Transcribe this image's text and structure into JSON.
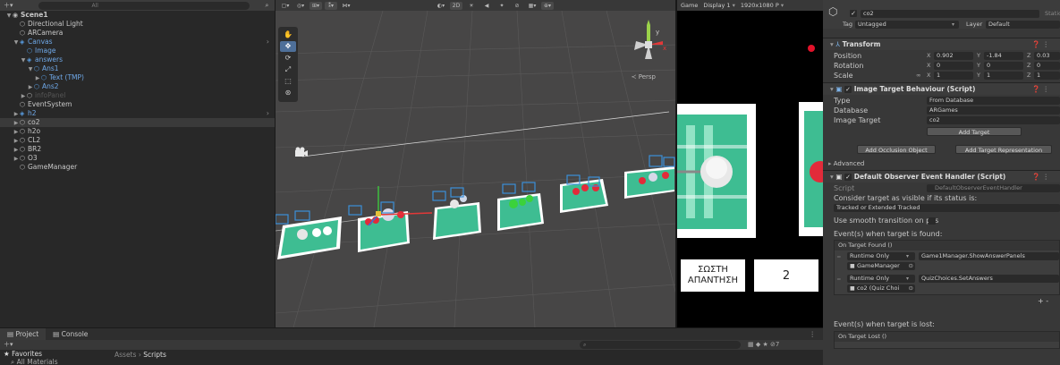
{
  "hierarchy": {
    "search_placeholder": "All",
    "rows": [
      {
        "name": "Scene1",
        "depth": 0,
        "arrow": "▼",
        "icon": "scene",
        "selected": false,
        "blue": false,
        "dim": false,
        "chev": false
      },
      {
        "name": "Directional Light",
        "depth": 1,
        "arrow": "",
        "icon": "cube",
        "selected": false,
        "blue": false,
        "dim": false,
        "chev": false
      },
      {
        "name": "ARCamera",
        "depth": 1,
        "arrow": "",
        "icon": "cube",
        "selected": false,
        "blue": false,
        "dim": false,
        "chev": false
      },
      {
        "name": "Canvas",
        "depth": 1,
        "arrow": "▼",
        "icon": "prefab",
        "selected": false,
        "blue": true,
        "dim": false,
        "chev": true
      },
      {
        "name": "Image",
        "depth": 2,
        "arrow": "",
        "icon": "cube",
        "selected": false,
        "blue": true,
        "dim": false,
        "chev": false
      },
      {
        "name": "answers",
        "depth": 2,
        "arrow": "▼",
        "icon": "prefab",
        "selected": false,
        "blue": true,
        "dim": false,
        "chev": false
      },
      {
        "name": "Ans1",
        "depth": 3,
        "arrow": "▼",
        "icon": "cube",
        "selected": false,
        "blue": true,
        "dim": false,
        "chev": false
      },
      {
        "name": "Text (TMP)",
        "depth": 4,
        "arrow": "▶",
        "icon": "cube",
        "selected": false,
        "blue": true,
        "dim": false,
        "chev": false
      },
      {
        "name": "Ans2",
        "depth": 3,
        "arrow": "▶",
        "icon": "cube",
        "selected": false,
        "blue": true,
        "dim": false,
        "chev": false
      },
      {
        "name": "infoPanel",
        "depth": 2,
        "arrow": "▶",
        "icon": "cube",
        "selected": false,
        "blue": false,
        "dim": true,
        "chev": false
      },
      {
        "name": "EventSystem",
        "depth": 1,
        "arrow": "",
        "icon": "cube",
        "selected": false,
        "blue": false,
        "dim": false,
        "chev": false
      },
      {
        "name": "h2",
        "depth": 1,
        "arrow": "▶",
        "icon": "prefab",
        "selected": false,
        "blue": true,
        "dim": false,
        "chev": true
      },
      {
        "name": "co2",
        "depth": 1,
        "arrow": "▶",
        "icon": "cube",
        "selected": true,
        "blue": false,
        "dim": false,
        "chev": false
      },
      {
        "name": "h2o",
        "depth": 1,
        "arrow": "▶",
        "icon": "cube",
        "selected": false,
        "blue": false,
        "dim": false,
        "chev": false
      },
      {
        "name": "CL2",
        "depth": 1,
        "arrow": "▶",
        "icon": "cube",
        "selected": false,
        "blue": false,
        "dim": false,
        "chev": false
      },
      {
        "name": "BR2",
        "depth": 1,
        "arrow": "▶",
        "icon": "cube",
        "selected": false,
        "blue": false,
        "dim": false,
        "chev": false
      },
      {
        "name": "O3",
        "depth": 1,
        "arrow": "▶",
        "icon": "cube",
        "selected": false,
        "blue": false,
        "dim": false,
        "chev": false
      },
      {
        "name": "GameManager",
        "depth": 1,
        "arrow": "",
        "icon": "cube",
        "selected": false,
        "blue": false,
        "dim": false,
        "chev": false
      }
    ]
  },
  "scene": {
    "toolbar": [
      "2D",
      "Persp"
    ],
    "persp_label": "≺ Persp"
  },
  "game": {
    "tab_label": "Game",
    "display": "Display 1",
    "resolution": "1920x1080 P",
    "answer_label_line1": "ΣΩΣΤΗ",
    "answer_label_line2": "ΑΠΑΝΤΗΣΗ",
    "answer_value": "2"
  },
  "inspector": {
    "object_name": "co2",
    "static_label": "Static",
    "tag_label": "Tag",
    "tag_value": "Untagged",
    "layer_label": "Layer",
    "layer_value": "Default",
    "transform": {
      "title": "Transform",
      "position_label": "Position",
      "rotation_label": "Rotation",
      "scale_label": "Scale",
      "position": {
        "x": "0.902",
        "y": "-1.84",
        "z": "0.03"
      },
      "rotation": {
        "x": "0",
        "y": "0",
        "z": "0"
      },
      "scale": {
        "x": "1",
        "y": "1",
        "z": "1"
      }
    },
    "image_target": {
      "title": "Image Target Behaviour (Script)",
      "type_label": "Type",
      "type_value": "From Database",
      "database_label": "Database",
      "database_value": "ARGames",
      "target_label": "Image Target",
      "target_value": "co2",
      "add_target": "Add Target",
      "add_occlusion": "Add Occlusion Object",
      "add_representation": "Add Target Representation",
      "advanced": "Advanced"
    },
    "observer": {
      "title": "Default Observer Event Handler (Script)",
      "script_label": "Script",
      "script_value": "DefaultObserverEventHandler",
      "consider_label": "Consider target as visible if its status is:",
      "status_value": "Tracked or Extended Tracked",
      "smooth_label": "Use smooth transition on pos",
      "found_label": "Event(s) when target is found:",
      "found_header": "On Target Found ()",
      "events": [
        {
          "mode": "Runtime Only",
          "func": "Game1Manager.ShowAnswerPanels",
          "obj": "GameManager"
        },
        {
          "mode": "Runtime Only",
          "func": "QuizChoices.SetAnswers",
          "obj": "co2 (Quiz Choi"
        }
      ],
      "plus": "+ -",
      "lost_label": "Event(s) when target is lost:",
      "lost_header": "On Target Lost ()"
    }
  },
  "project": {
    "tabs": [
      "Project",
      "Console"
    ],
    "favorites": "Favorites",
    "fav_item": "All Materials",
    "breadcrumb_root": "Assets",
    "breadcrumb_current": "Scripts",
    "icon_count": "7"
  }
}
